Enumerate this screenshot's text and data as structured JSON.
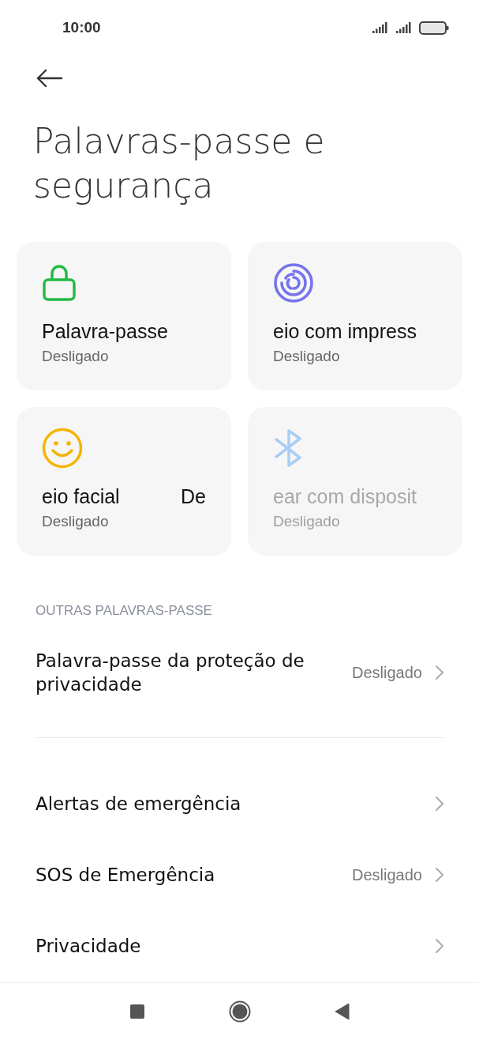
{
  "status_bar": {
    "time": "10:00"
  },
  "title": "Palavras-passe e segurança",
  "tiles": [
    {
      "kind": "lock",
      "title": "Palavra-passe",
      "status": "Desligado",
      "disabled": false
    },
    {
      "kind": "fingerprint",
      "title": "eio com impress",
      "status": "Desligado",
      "disabled": false
    },
    {
      "kind": "face",
      "title": "eio facial",
      "title_tail": "De",
      "status": "Desligado",
      "disabled": false
    },
    {
      "kind": "bluetooth",
      "title": "ear com disposit",
      "status": "Desligado",
      "disabled": true
    }
  ],
  "section_header": "OUTRAS PALAVRAS-PASSE",
  "groups": [
    [
      {
        "label": "Palavra-passe da proteção de privacidade",
        "value": "Desligado"
      }
    ],
    [
      {
        "label": "Alertas de emergência"
      },
      {
        "label": "SOS de Emergência",
        "value": "Desligado"
      },
      {
        "label": "Privacidade"
      }
    ]
  ]
}
